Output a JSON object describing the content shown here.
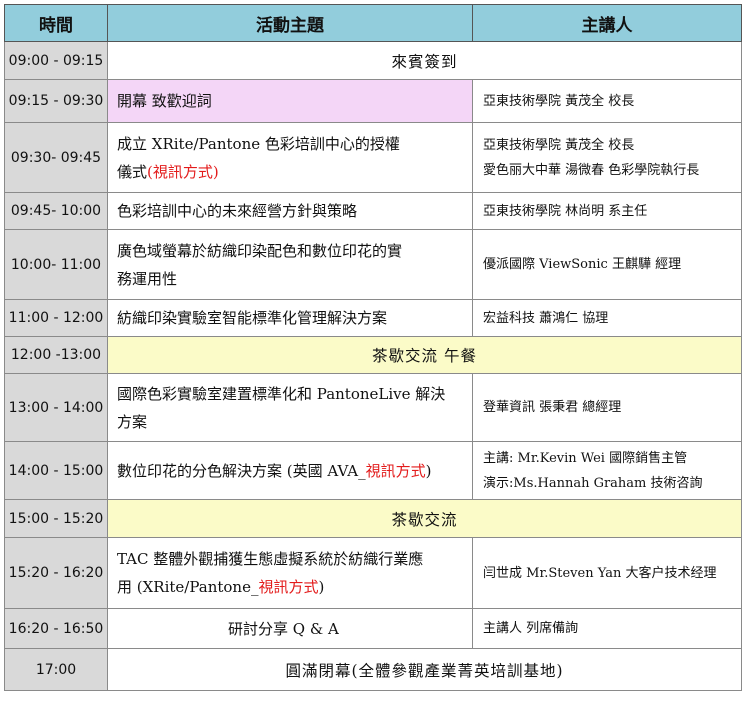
{
  "headers": {
    "time": "時間",
    "topic": "活動主題",
    "speaker": "主講人"
  },
  "rows": [
    {
      "time": "09:00 - 09:15",
      "center": "來賓簽到"
    },
    {
      "time": "09:15 - 09:30",
      "topic": [
        "開幕 致歡迎詞"
      ],
      "speaker": [
        "亞東技術學院 黃茂全 校長"
      ]
    },
    {
      "time": "09:30- 09:45",
      "topic": [
        "成立 XRite/Pantone 色彩培訓中心的授權",
        "儀式"
      ],
      "topic_red": "(視訊方式)",
      "speaker": [
        "亞東技術學院 黃茂全 校長",
        "愛色丽大中華 湯微春 色彩學院執行長"
      ]
    },
    {
      "time": "09:45- 10:00",
      "topic": [
        "色彩培訓中心的未來經營方針與策略"
      ],
      "speaker": [
        "亞東技術學院 林尚明 系主任"
      ]
    },
    {
      "time": "10:00- 11:00",
      "topic": [
        "廣色域螢幕於紡織印染配色和數位印花的實",
        "務運用性"
      ],
      "speaker": [
        "優派國際 ViewSonic 王麒驊 經理"
      ]
    },
    {
      "time": "11:00 - 12:00",
      "topic": [
        "紡織印染實驗室智能標準化管理解決方案"
      ],
      "speaker": [
        "宏益科技 蕭鴻仁 協理"
      ]
    },
    {
      "time": "12:00 -13:00",
      "center": "茶歇交流 午餐"
    },
    {
      "time": "13:00 - 14:00",
      "topic": [
        "國際色彩實驗室建置標準化和 PantoneLive 解決",
        "方案"
      ],
      "speaker": [
        "登華資訊 張秉君 總經理"
      ]
    },
    {
      "time": "14:00 - 15:00",
      "topic": [
        "數位印花的分色解決方案 (英國 AVA_"
      ],
      "topic_red": "視訊方式",
      "topic_tail": ")",
      "speaker": [
        "主講: Mr.Kevin Wei 國際銷售主管",
        "演示:Ms.Hannah Graham 技術咨詢"
      ]
    },
    {
      "time": "15:00 - 15:20",
      "center": "茶歇交流"
    },
    {
      "time": "15:20 - 16:20",
      "topic": [
        "TAC 整體外觀捕獲生態虛擬系統於紡織行業應",
        "用 (XRite/Pantone_"
      ],
      "topic_red": "視訊方式",
      "topic_tail": ")",
      "speaker": [
        "闫世成 Mr.Steven Yan 大客户技术经理"
      ]
    },
    {
      "time": "16:20 - 16:50",
      "topic": [
        "研討分享 Q & A"
      ],
      "speaker": [
        "主講人 列席備詢"
      ]
    },
    {
      "time": "17:00",
      "center": "圓滿閉幕(全體參觀產業菁英培訓基地)"
    }
  ]
}
